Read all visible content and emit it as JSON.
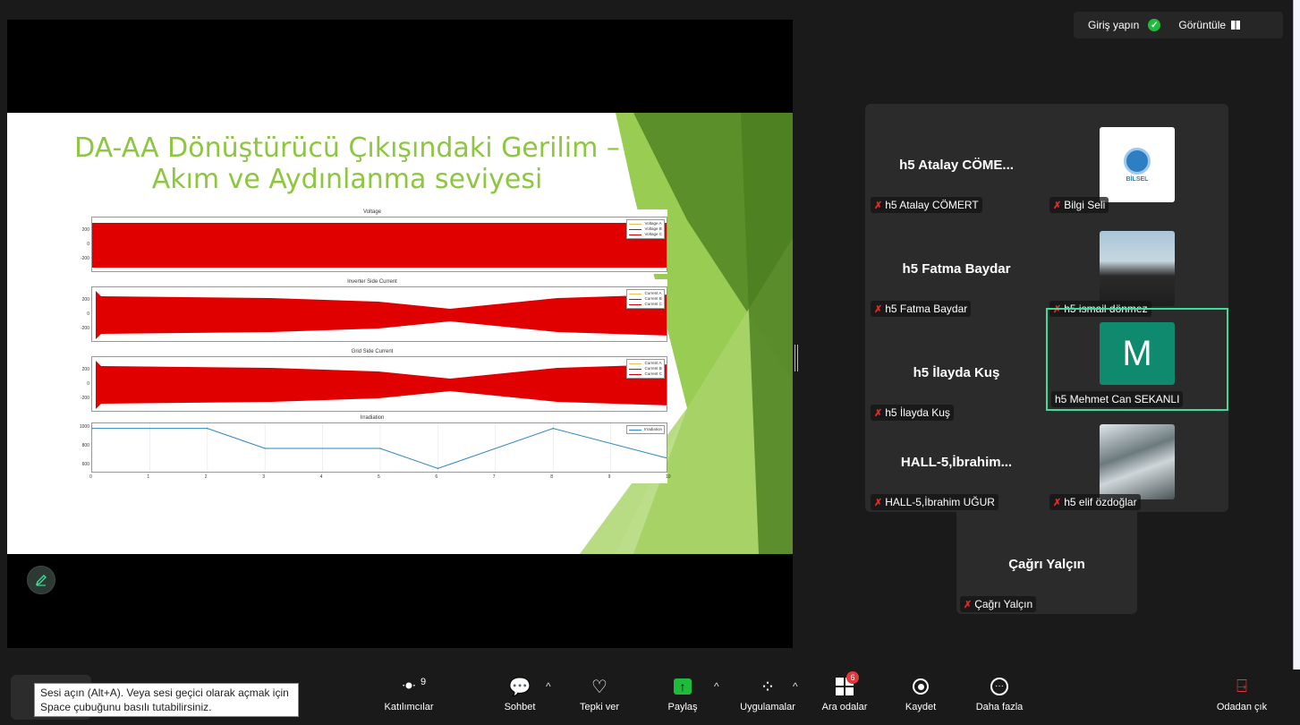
{
  "topbar": {
    "signin": "Giriş yapın",
    "view": "Görüntüle"
  },
  "slide": {
    "title_line1": "DA-AA Dönüştürücü Çıkışındaki Gerilim –",
    "title_line2": "Akım ve Aydınlanma seviyesi"
  },
  "chart_data": [
    {
      "type": "line",
      "title": "Voltage",
      "yticks": [
        "200",
        "0",
        "-200"
      ],
      "series": [
        {
          "name": "Voltage A"
        },
        {
          "name": "Voltage B"
        },
        {
          "name": "Voltage C"
        }
      ]
    },
    {
      "type": "line",
      "title": "Inverter Side Current",
      "yticks": [
        "200",
        "0",
        "-200"
      ],
      "series": [
        {
          "name": "Current A"
        },
        {
          "name": "Current B"
        },
        {
          "name": "Current C"
        }
      ]
    },
    {
      "type": "line",
      "title": "Grid Side Current",
      "yticks": [
        "200",
        "0",
        "-200"
      ],
      "series": [
        {
          "name": "Current A"
        },
        {
          "name": "Current B"
        },
        {
          "name": "Current C"
        }
      ]
    },
    {
      "type": "line",
      "title": "Irradiation",
      "x": [
        0,
        2,
        3,
        5,
        6,
        8,
        10
      ],
      "y": [
        1000,
        1000,
        800,
        800,
        600,
        1000,
        700
      ],
      "xticks": [
        "0",
        "1",
        "2",
        "3",
        "4",
        "5",
        "6",
        "7",
        "8",
        "9",
        "10"
      ],
      "yticks": [
        "1000",
        "800",
        "600"
      ],
      "ylim": [
        550,
        1050
      ],
      "series": [
        {
          "name": "Irradiation",
          "color": "#2e86c1"
        }
      ]
    }
  ],
  "gallery": {
    "tiles": [
      {
        "center": "h5 Atalay CÖME...",
        "tag": "h5 Atalay CÖMERT"
      },
      {
        "tag": "Bilgi Seli"
      },
      {
        "center": "h5 Fatma Baydar",
        "tag": "h5 Fatma Baydar"
      },
      {
        "tag": "h5 ismail dönmez"
      },
      {
        "center": "h5 İlayda Kuş",
        "tag": "h5 İlayda Kuş"
      },
      {
        "avatar_letter": "M",
        "tag": "h5 Mehmet Can SEKANLI"
      },
      {
        "center": "HALL-5,İbrahim...",
        "tag": "HALL-5,İbrahim UĞUR"
      },
      {
        "tag": "h5 elif özdoğlar"
      }
    ],
    "extra": {
      "center": "Çağrı Yalçın",
      "tag": "Çağrı Yalçın"
    },
    "logo_text": "BİLSEL"
  },
  "toolbar": {
    "participants_count": "9",
    "participants": "Katılımcılar",
    "chat": "Sohbet",
    "react": "Tepki ver",
    "share": "Paylaş",
    "apps": "Uygulamalar",
    "breakout": "Ara odalar",
    "breakout_badge": "6",
    "record": "Kaydet",
    "more": "Daha fazla",
    "leave": "Odadan çık"
  },
  "tooltip": {
    "line1": "Sesi açın (Alt+A). Veya sesi geçici olarak açmak için",
    "line2": "Space çubuğunu basılı tutabilirsiniz."
  },
  "colors": {
    "accent_green": "#8dc63f",
    "active_border": "#3ddc97",
    "badge_red": "#e0383e"
  }
}
